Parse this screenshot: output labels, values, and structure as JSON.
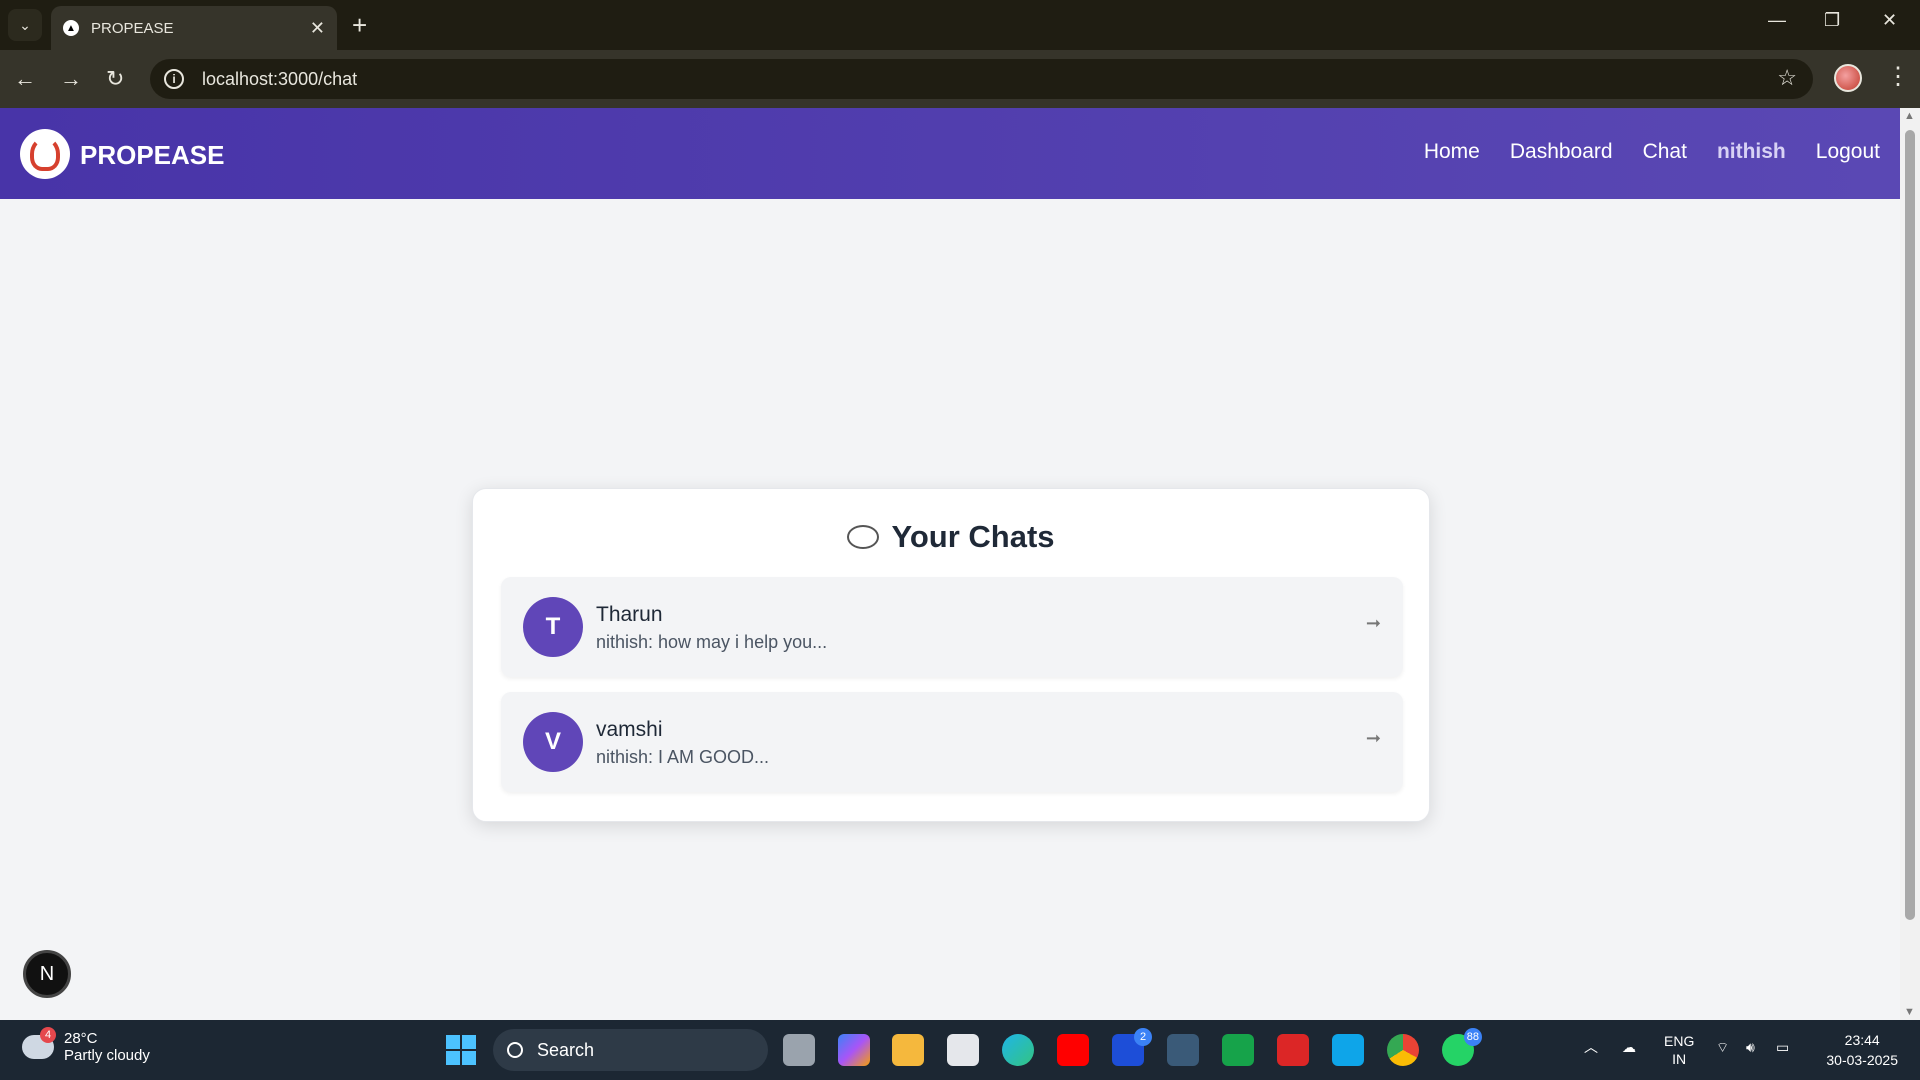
{
  "browser": {
    "tab_title": "PROPEASE",
    "url": "localhost:3000/chat"
  },
  "navbar": {
    "brand": "PROPEASE",
    "links": [
      "Home",
      "Dashboard",
      "Chat",
      "nithish",
      "Logout"
    ]
  },
  "chats": {
    "title": "Your Chats",
    "items": [
      {
        "initial": "T",
        "name": "Tharun",
        "preview": "nithish: how may i help you..."
      },
      {
        "initial": "V",
        "name": "vamshi",
        "preview": "nithish: I AM GOOD..."
      }
    ]
  },
  "dev_badge": "N",
  "taskbar": {
    "weather_temp": "28°C",
    "weather_desc": "Partly cloudy",
    "weather_badge": "4",
    "search_label": "Search",
    "lens_badge": "2",
    "whatsapp_badge": "88",
    "lang_primary": "ENG",
    "lang_secondary": "IN",
    "time": "23:44",
    "date": "30-03-2025"
  },
  "colors": {
    "navbar_start": "#4834a8",
    "navbar_end": "#5a48b4",
    "avatar": "#6046b8"
  }
}
